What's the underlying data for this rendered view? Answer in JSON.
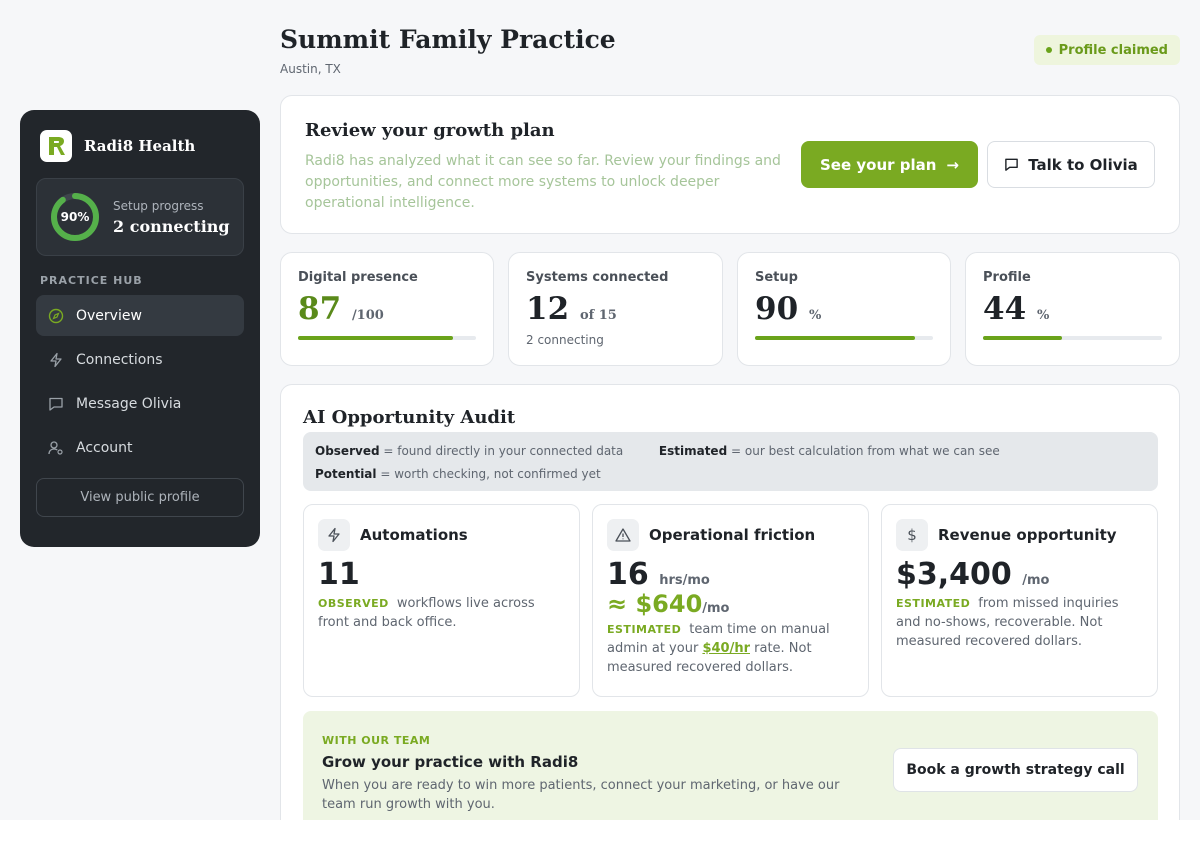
{
  "header": {
    "title": "Summit Family Practice",
    "location": "Austin, TX",
    "badge": "Profile claimed"
  },
  "sidebar": {
    "brand": "Radi8 Health",
    "progress": {
      "label": "Setup progress",
      "percent_text": "90%",
      "percent": 90,
      "value": "2 connecting"
    },
    "section_title": "PRACTICE HUB",
    "items": [
      {
        "label": "Overview",
        "icon": "compass-icon",
        "active": true
      },
      {
        "label": "Connections",
        "icon": "bolt-icon"
      },
      {
        "label": "Message Olivia",
        "icon": "chat-icon"
      },
      {
        "label": "Account",
        "icon": "user-settings-icon"
      }
    ],
    "public_profile": "View public profile"
  },
  "growth": {
    "title": "Review your growth plan",
    "description": "Radi8 has analyzed what it can see so far. Review your findings and opportunities, and connect more systems to unlock deeper operational intelligence.",
    "primary_button": "See your plan",
    "secondary_button": "Talk to Olivia"
  },
  "stats": [
    {
      "label": "Digital presence",
      "value": "87",
      "unit": "/100",
      "progress": 87
    },
    {
      "label": "Systems connected",
      "value": "12",
      "unit": "of 15",
      "sub": "2 connecting"
    },
    {
      "label": "Setup",
      "value": "90",
      "unit": "%",
      "progress": 90
    },
    {
      "label": "Profile",
      "value": "44",
      "unit": "%",
      "progress": 44
    }
  ],
  "audit": {
    "title": "AI Opportunity Audit",
    "legend": {
      "observed_term": "Observed",
      "observed_def": "= found directly in your connected data",
      "estimated_term": "Estimated",
      "estimated_def": "= our best calculation from what we can see",
      "potential_term": "Potential",
      "potential_def": "= worth checking, not confirmed yet"
    },
    "cards": [
      {
        "title": "Automations",
        "icon": "bolt-icon",
        "value": "11",
        "unit": "",
        "tag": "OBSERVED",
        "text": "workflows live across front and back office."
      },
      {
        "title": "Operational friction",
        "icon": "warning-icon",
        "value": "16",
        "unit": "hrs/mo",
        "sub_value": "≈ $640",
        "sub_unit": "/mo",
        "tag": "ESTIMATED",
        "text_before": "team time on manual admin at your",
        "rate": "$40/hr",
        "text_after": "rate. Not measured recovered dollars."
      },
      {
        "title": "Revenue opportunity",
        "icon": "dollar-icon",
        "value": "$3,400",
        "unit": "/mo",
        "tag": "ESTIMATED",
        "text": "from missed inquiries and no-shows, recoverable. Not measured recovered dollars."
      }
    ]
  },
  "team": {
    "eyebrow": "WITH OUR TEAM",
    "title": "Grow your practice with Radi8",
    "description": "When you are ready to win more patients, connect your marketing, or have our team run growth with you.",
    "button": "Book a growth strategy call"
  },
  "colors": {
    "accent": "#7aaa22",
    "sidebar": "#22262b",
    "accent_soft": "#eef5e3"
  }
}
